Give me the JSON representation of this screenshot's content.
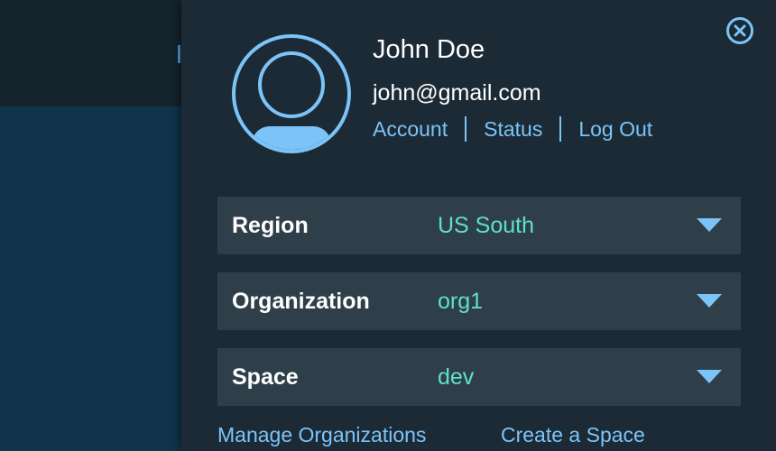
{
  "user": {
    "name": "John Doe",
    "email": "john@gmail.com"
  },
  "account_links": {
    "account": "Account",
    "status": "Status",
    "logout": "Log Out"
  },
  "selectors": {
    "region": {
      "label": "Region",
      "value": "US South"
    },
    "organization": {
      "label": "Organization",
      "value": "org1"
    },
    "space": {
      "label": "Space",
      "value": "dev"
    }
  },
  "footer_links": {
    "manage_orgs": "Manage Organizations",
    "create_space": "Create a Space"
  },
  "icons": {
    "close": "close-circle-icon",
    "avatar": "user-avatar-icon",
    "caret": "caret-down-icon"
  },
  "colors": {
    "panel_bg": "#1c2a36",
    "selector_bg": "#2f3f4a",
    "link": "#7cc4f8",
    "value": "#5ee0c8",
    "background_body": "#103449"
  }
}
